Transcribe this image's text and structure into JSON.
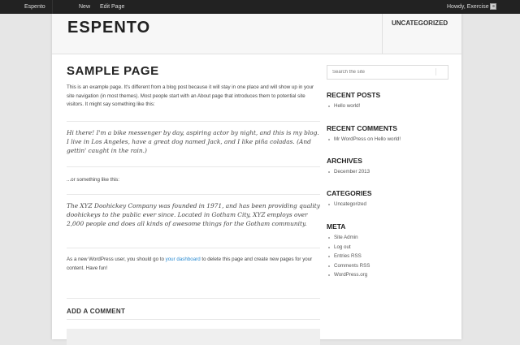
{
  "adminbar": {
    "site": "Espento",
    "new": "New",
    "edit": "Edit Page",
    "howdy": "Howdy, Exercise"
  },
  "header": {
    "site_title": "ESPENTO",
    "nav": [
      "UNCATEGORIZED"
    ]
  },
  "content": {
    "title": "SAMPLE PAGE",
    "intro": "This is an example page. It's different from a blog post because it will stay in one place and will show up in your site navigation (in most themes). Most people start with an About page that introduces them to potential site visitors. It might say something like this:",
    "quote1": "Hi there! I'm a bike messenger by day, aspiring actor by night, and this is my blog. I live in Los Angeles, have a great dog named Jack, and I like piña coladas. (And gettin' caught in the rain.)",
    "middle": "...or something like this:",
    "quote2": "The XYZ Doohickey Company was founded in 1971, and has been providing quality doohickeys to the public ever since. Located in Gotham City, XYZ employs over 2,000 people and does all kinds of awesome things for the Gotham community.",
    "outro_before": "As a new WordPress user, you should go to ",
    "outro_link": "your dashboard",
    "outro_after": " to delete this page and create new pages for your content. Have fun!",
    "comment_heading": "ADD A COMMENT"
  },
  "sidebar": {
    "search_placeholder": "Search the site",
    "recent_posts": {
      "title": "RECENT POSTS",
      "items": [
        "Hello world!"
      ]
    },
    "recent_comments": {
      "title": "RECENT COMMENTS",
      "author": "Mr WordPress",
      "on": " on ",
      "post": "Hello world!"
    },
    "archives": {
      "title": "ARCHIVES",
      "items": [
        "December 2013"
      ]
    },
    "categories": {
      "title": "CATEGORIES",
      "items": [
        "Uncategorized"
      ]
    },
    "meta": {
      "title": "META",
      "items": [
        "Site Admin",
        "Log out",
        "Entries RSS",
        "Comments RSS",
        "WordPress.org"
      ]
    }
  },
  "colors": {
    "link": "#2a8bd1",
    "adminbar": "#222222",
    "background": "#e6e6e6"
  }
}
